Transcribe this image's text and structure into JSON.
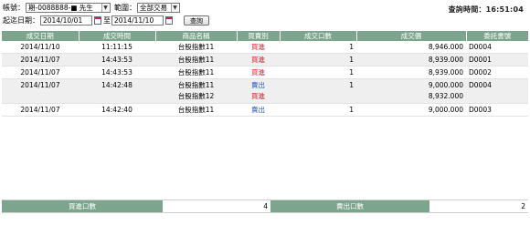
{
  "toolbar": {
    "account_label": "帳號：",
    "account_value": "期-0088888-■ 先生",
    "range_label": "範圍：",
    "range_value": "全部交易",
    "date_label": "起迄日期：",
    "start_date": "2014/10/01",
    "to_label": "至",
    "end_date": "2014/11/10",
    "query_button": "查詢",
    "query_time_label": "查詢時間：",
    "query_time": "16:51:04"
  },
  "table": {
    "headers": [
      "成交日期",
      "成交時間",
      "商品名稱",
      "買賣別",
      "成交口數",
      "成交價",
      "委託書號"
    ],
    "rows": [
      {
        "date": "2014/11/10",
        "time": "11:11:15",
        "product": "台股指數11",
        "side": "買進",
        "side_type": "buy",
        "qty": "1",
        "price": "8,946.000",
        "order": "D0004"
      },
      {
        "date": "2014/11/07",
        "time": "14:43:53",
        "product": "台股指數11",
        "side": "買進",
        "side_type": "buy",
        "qty": "1",
        "price": "8,939.000",
        "order": "D0001"
      },
      {
        "date": "2014/11/07",
        "time": "14:43:53",
        "product": "台股指數11",
        "side": "買進",
        "side_type": "buy",
        "qty": "1",
        "price": "8,939.000",
        "order": "D0002"
      },
      {
        "date": "2014/11/07",
        "time": "14:42:48",
        "product": "台股指數11",
        "product2": "台股指數12",
        "side": "賣出",
        "side_type": "sell",
        "side2": "買進",
        "qty": "1",
        "price": "9,000.000",
        "price2": "8,932.000",
        "order": "D0004"
      },
      {
        "date": "2014/11/07",
        "time": "14:42:40",
        "product": "台股指數11",
        "side": "賣出",
        "side_type": "sell",
        "qty": "1",
        "price": "9,000.000",
        "order": "D0003"
      }
    ]
  },
  "summary": {
    "buy_label": "買進口數",
    "buy_value": "4",
    "sell_label": "賣出口數",
    "sell_value": "2"
  },
  "colors": {
    "header_bg": "#7da58d",
    "buy": "#d8222a",
    "sell": "#2a56c6"
  }
}
